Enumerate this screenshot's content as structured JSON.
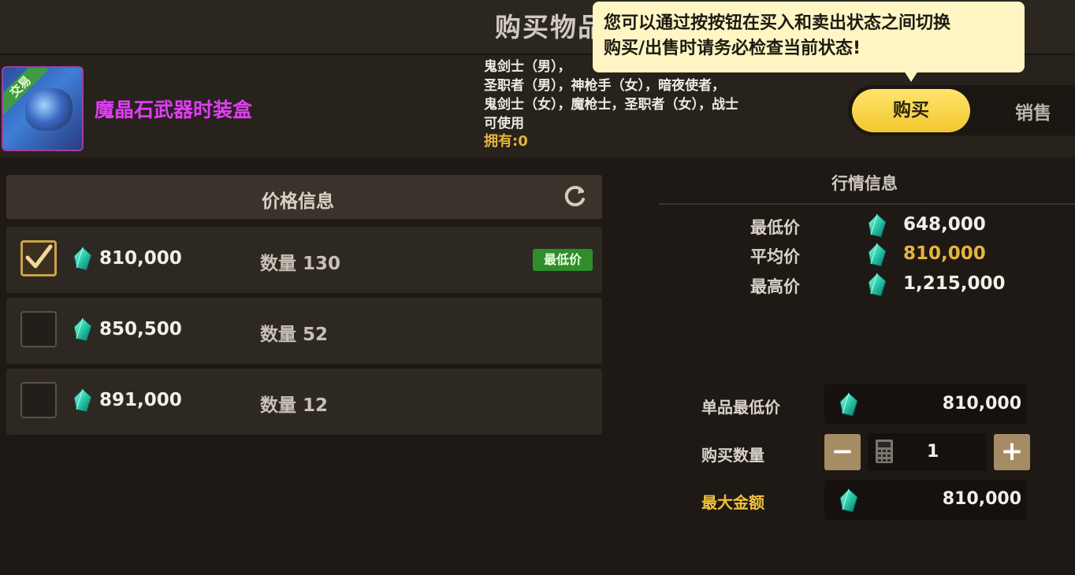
{
  "header": {
    "title": "购买物品"
  },
  "tooltip": {
    "line1": "您可以通过按按钮在买入和卖出状态之间切换",
    "line2": "购买/出售时请务必检查当前状态!"
  },
  "item": {
    "badge": "交易",
    "name": "魔晶石武器时装盒",
    "desc_lines": [
      "鬼剑士（男），",
      "圣职者（男），神枪手（女），暗夜使者，",
      "鬼剑士（女），魔枪士，圣职者（女），战士",
      "可使用"
    ],
    "owned": "拥有:0"
  },
  "mode_toggle": {
    "buy": "购买",
    "sell": "销售"
  },
  "price_panel": {
    "title": "价格信息",
    "lowest_tag": "最低价",
    "rows": [
      {
        "price": "810,000",
        "qty_label": "数量",
        "qty": "130",
        "checked": true
      },
      {
        "price": "850,500",
        "qty_label": "数量",
        "qty": "52",
        "checked": false
      },
      {
        "price": "891,000",
        "qty_label": "数量",
        "qty": "12",
        "checked": false
      }
    ]
  },
  "market": {
    "title": "行情信息",
    "lowest_label": "最低价",
    "lowest_value": "648,000",
    "avg_label": "平均价",
    "avg_value": "810,000",
    "highest_label": "最高价",
    "highest_value": "1,215,000"
  },
  "purchase": {
    "unit_min_label": "单品最低价",
    "unit_min_value": "810,000",
    "qty_label": "购买数量",
    "qty_value": "1",
    "max_label": "最大金额",
    "max_value": "810,000",
    "minus": "−",
    "plus": "+"
  },
  "colors": {
    "gem": "#28c9a9",
    "accent": "#f2c730",
    "item_name": "#e13df3",
    "lowest_tag": "#2f8d2c"
  },
  "icons": [
    "refresh-icon",
    "gem-icon",
    "check-icon",
    "calculator-icon"
  ]
}
